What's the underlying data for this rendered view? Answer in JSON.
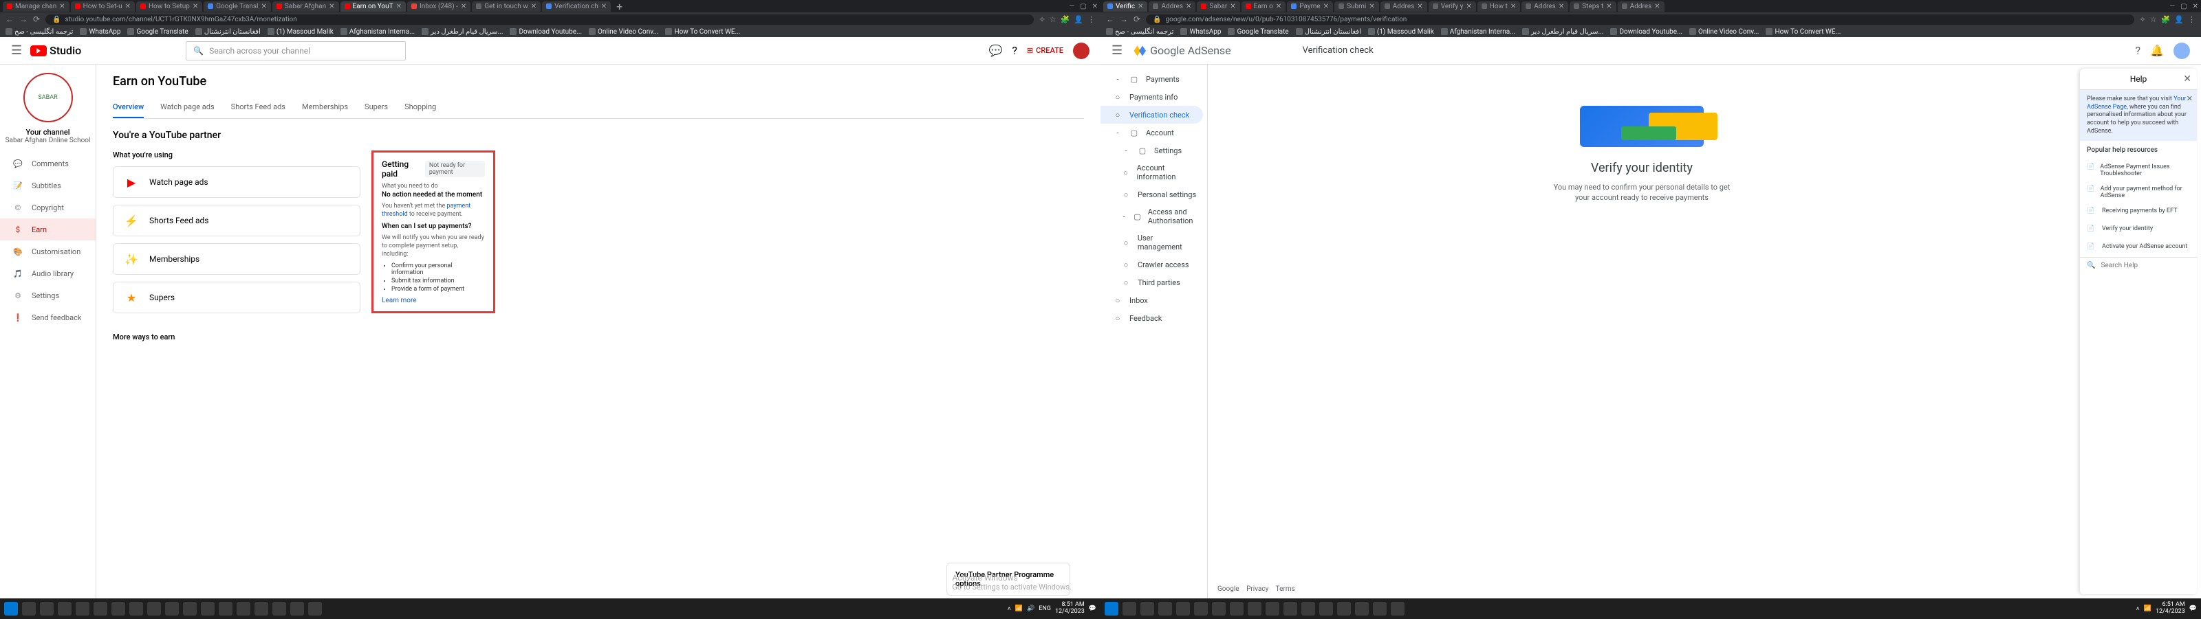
{
  "left_window": {
    "tabs": [
      {
        "label": "Manage chan",
        "favicon": "#f00"
      },
      {
        "label": "How to Set-u",
        "favicon": "#f00"
      },
      {
        "label": "How to Setup",
        "favicon": "#f00"
      },
      {
        "label": "Google Transl",
        "favicon": "#4285f4"
      },
      {
        "label": "Sabar Afghan",
        "favicon": "#f00"
      },
      {
        "label": "Earn on YouT",
        "favicon": "#f00",
        "active": true
      },
      {
        "label": "Inbox (248) -",
        "favicon": "#ea4335"
      },
      {
        "label": "Get in touch w",
        "favicon": "#5f6368"
      },
      {
        "label": "Verification ch",
        "favicon": "#4285f4"
      }
    ],
    "url": "studio.youtube.com/channel/UCT1rGTK0NX9hmGaZ47cxb3A/monetization",
    "bookmarks": [
      {
        "label": "ترجمه انگلیسی - صح"
      },
      {
        "label": "WhatsApp"
      },
      {
        "label": "Google Translate"
      },
      {
        "label": "افغانستان انترنشنال"
      },
      {
        "label": "(1) Massoud Malik"
      },
      {
        "label": "Afghanistan Interna..."
      },
      {
        "label": "سریال قیام ارطغرل دیر..."
      },
      {
        "label": "Download Youtube..."
      },
      {
        "label": "Online Video Conv..."
      },
      {
        "label": "How To Convert WE..."
      }
    ],
    "studio": {
      "logo": "Studio",
      "search_placeholder": "Search across your channel",
      "create": "CREATE",
      "channel_label": "Your channel",
      "channel_name": "Sabar Afghan Online School",
      "nav": [
        {
          "icon": "💬",
          "label": "Comments"
        },
        {
          "icon": "📝",
          "label": "Subtitles"
        },
        {
          "icon": "©",
          "label": "Copyright"
        },
        {
          "icon": "$",
          "label": "Earn",
          "active": true
        },
        {
          "icon": "🎨",
          "label": "Customisation"
        },
        {
          "icon": "🎵",
          "label": "Audio library"
        },
        {
          "icon": "⚙",
          "label": "Settings"
        },
        {
          "icon": "❗",
          "label": "Send feedback"
        }
      ],
      "title": "Earn on YouTube",
      "tabs": [
        {
          "label": "Overview",
          "active": true
        },
        {
          "label": "Watch page ads"
        },
        {
          "label": "Shorts Feed ads"
        },
        {
          "label": "Memberships"
        },
        {
          "label": "Supers"
        },
        {
          "label": "Shopping"
        }
      ],
      "partner": "You're a YouTube partner",
      "using_header": "What you're using",
      "using": [
        {
          "icon": "▶",
          "label": "Watch page ads",
          "color": "#f00"
        },
        {
          "icon": "⚡",
          "label": "Shorts Feed ads",
          "color": "#f9a825"
        },
        {
          "icon": "✨",
          "label": "Memberships",
          "color": "#fdd835"
        },
        {
          "icon": "★",
          "label": "Supers",
          "color": "#fb8c00"
        }
      ],
      "pay": {
        "title": "Getting paid",
        "badge": "Not ready for payment",
        "sub": "What you need to do",
        "noaction": "No action needed at the moment",
        "threshold_pre": "You haven't yet met the ",
        "threshold_link": "payment threshold",
        "threshold_post": " to receive payment.",
        "when": "When can I set up payments?",
        "notify": "We will notify you when you are ready to complete payment setup, including:",
        "list": [
          "Confirm your personal information",
          "Submit tax information",
          "Provide a form of payment"
        ],
        "learn": "Learn more"
      },
      "more": "More ways to earn",
      "ypp": "YouTube Partner Programme options",
      "activate_title": "Activate Windows",
      "activate_sub": "Go to Settings to activate Windows."
    },
    "clock": {
      "time": "8:51 AM",
      "date": "12/4/2023",
      "lang": "ENG"
    }
  },
  "right_window": {
    "tabs": [
      {
        "label": "Verific",
        "favicon": "#4285f4",
        "active": true
      },
      {
        "label": "Addres",
        "favicon": "#5f6368"
      },
      {
        "label": "Sabar",
        "favicon": "#f00"
      },
      {
        "label": "Earn o",
        "favicon": "#f00"
      },
      {
        "label": "Payme",
        "favicon": "#4285f4"
      },
      {
        "label": "Submi",
        "favicon": "#5f6368"
      },
      {
        "label": "Addres",
        "favicon": "#5f6368"
      },
      {
        "label": "Verify y",
        "favicon": "#5f6368"
      },
      {
        "label": "How t",
        "favicon": "#5f6368"
      },
      {
        "label": "Addres",
        "favicon": "#5f6368"
      },
      {
        "label": "Steps t",
        "favicon": "#5f6368"
      },
      {
        "label": "Addres",
        "favicon": "#5f6368"
      }
    ],
    "url": "google.com/adsense/new/u/0/pub-7610310874535776/payments/verification",
    "bookmarks": [
      {
        "label": "ترجمه انگلیسی - صح"
      },
      {
        "label": "WhatsApp"
      },
      {
        "label": "Google Translate"
      },
      {
        "label": "افغانستان انترنشنال"
      },
      {
        "label": "(1) Massoud Malik"
      },
      {
        "label": "Afghanistan Interna..."
      },
      {
        "label": "سریال قیام ارطغرل دیر..."
      },
      {
        "label": "Download Youtube..."
      },
      {
        "label": "Online Video Conv..."
      },
      {
        "label": "How To Convert WE..."
      }
    ],
    "adsense": {
      "logo": "Google AdSense",
      "header_title": "Verification check",
      "nav": [
        {
          "label": "Payments",
          "type": "h",
          "expand": "-"
        },
        {
          "label": "Payments info",
          "type": "i"
        },
        {
          "label": "Verification check",
          "type": "i",
          "active": true
        },
        {
          "label": "Account",
          "type": "h",
          "expand": "-"
        },
        {
          "label": "Settings",
          "type": "h2",
          "expand": "-"
        },
        {
          "label": "Account information",
          "type": "i2"
        },
        {
          "label": "Personal settings",
          "type": "i2"
        },
        {
          "label": "Access and Authorisation",
          "type": "h2",
          "expand": "-"
        },
        {
          "label": "User management",
          "type": "i2"
        },
        {
          "label": "Crawler access",
          "type": "i2"
        },
        {
          "label": "Third parties",
          "type": "i2"
        },
        {
          "label": "Inbox",
          "type": "i"
        },
        {
          "label": "Feedback",
          "type": "i"
        }
      ],
      "verify_h": "Verify your identity",
      "verify_p": "You may need to confirm your personal details to get your account ready to receive payments",
      "footer": {
        "google": "Google",
        "privacy": "Privacy",
        "terms": "Terms"
      },
      "help": {
        "title": "Help",
        "tip_pre": "Please make sure that you visit ",
        "tip_link": "Your AdSense Page",
        "tip_post": ", where you can find personalised information about your account to help you succeed with AdSense.",
        "popular": "Popular help resources",
        "items": [
          "AdSense Payment Issues Troubleshooter",
          "Add your payment method for AdSense",
          "Receiving payments by EFT",
          "Verify your identity",
          "Activate your AdSense account"
        ],
        "search_placeholder": "Search Help"
      }
    },
    "clock": {
      "time": "6:51 AM",
      "date": "12/4/2023"
    }
  }
}
